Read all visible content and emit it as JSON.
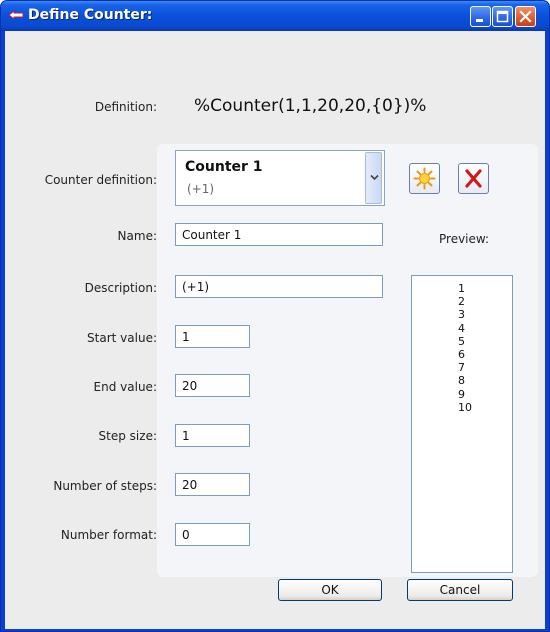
{
  "window": {
    "title": "Define Counter:"
  },
  "definition": {
    "label": "Definition:",
    "value": "%Counter(1,1,20,20,{0})%"
  },
  "counter_definition": {
    "label": "Counter definition:",
    "selected_title": "Counter 1",
    "selected_subtitle": "(+1)"
  },
  "toolbar": {
    "new_icon": "sun-star-icon",
    "delete_icon": "red-x-delete-icon"
  },
  "fields": {
    "name": {
      "label": "Name:",
      "value": "Counter 1"
    },
    "description": {
      "label": "Description:",
      "value": "(+1)"
    },
    "start_value": {
      "label": "Start value:",
      "value": "1"
    },
    "end_value": {
      "label": "End value:",
      "value": "20"
    },
    "step_size": {
      "label": "Step size:",
      "value": "1"
    },
    "number_of_steps": {
      "label": "Number of steps:",
      "value": "20"
    },
    "number_format": {
      "label": "Number format:",
      "value": "0"
    }
  },
  "preview": {
    "label": "Preview:",
    "items": [
      "1",
      "2",
      "3",
      "4",
      "5",
      "6",
      "7",
      "8",
      "9",
      "10"
    ]
  },
  "buttons": {
    "ok": "OK",
    "cancel": "Cancel"
  },
  "colors": {
    "titlebar": "#0a49d0",
    "client_bg": "#ececec",
    "panel_bg": "#f3f5f8",
    "close_button": "#e05a2c"
  }
}
